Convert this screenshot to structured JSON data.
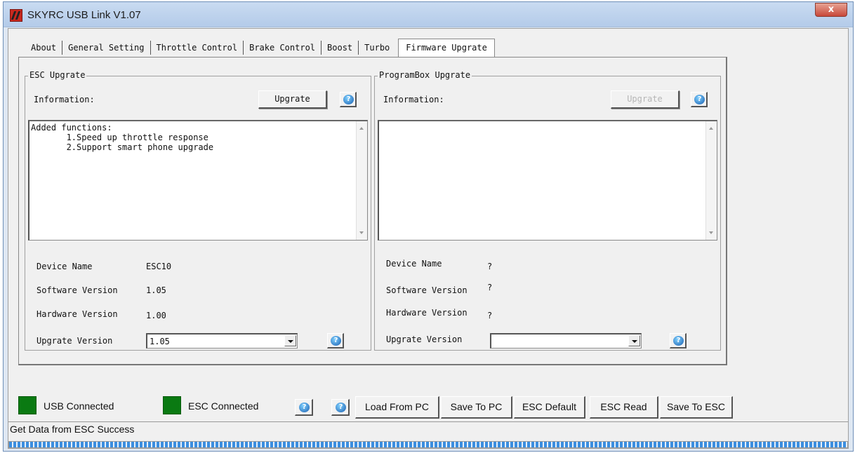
{
  "window": {
    "title": "SKYRC USB Link V1.07",
    "close_glyph": "x"
  },
  "tabs": [
    {
      "label": "About"
    },
    {
      "label": "General Setting"
    },
    {
      "label": "Throttle Control"
    },
    {
      "label": "Brake Control"
    },
    {
      "label": "Boost"
    },
    {
      "label": "Turbo"
    },
    {
      "label": "Firmware Upgrate",
      "active": true
    }
  ],
  "esc_upgrate": {
    "title": "ESC Upgrate",
    "information_label": "Information:",
    "upgrate_button": "Upgrate",
    "text": "Added functions:\n       1.Speed up throttle response\n       2.Support smart phone upgrade",
    "device_name_label": "Device Name",
    "device_name": "ESC10",
    "software_version_label": "Software Version",
    "software_version": "1.05",
    "hardware_version_label": "Hardware Version",
    "hardware_version": "1.00",
    "upgrate_version_label": "Upgrate Version",
    "upgrate_version": "1.05"
  },
  "programbox_upgrate": {
    "title": "ProgramBox Upgrate",
    "information_label": "Information:",
    "upgrate_button": "Upgrate",
    "text": "",
    "device_name_label": "Device Name",
    "device_name": "?",
    "software_version_label": "Software Version",
    "software_version": "?",
    "hardware_version_label": "Hardware Version",
    "hardware_version": "?",
    "upgrate_version_label": "Upgrate Version",
    "upgrate_version": ""
  },
  "bottom": {
    "usb_connected": "USB Connected",
    "esc_connected": "ESC Connected",
    "buttons": {
      "load_from_pc": "Load From PC",
      "save_to_pc": "Save To PC",
      "esc_default": "ESC Default",
      "esc_read": "ESC Read",
      "save_to_esc": "Save To ESC"
    },
    "indicator_color": "#0a7a12"
  },
  "status": {
    "text": "Get Data from ESC Success",
    "progress_percent": 100
  },
  "help_glyph": "?"
}
